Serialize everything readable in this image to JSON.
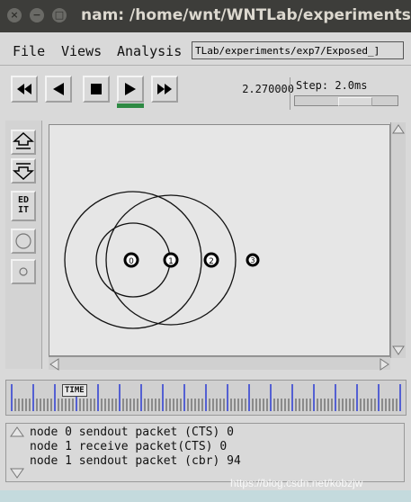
{
  "window": {
    "title": "nam: /home/wnt/WNTLab/experiments/e",
    "close_glyph": "×",
    "minimize_glyph": "−",
    "maximize_glyph": "□"
  },
  "menu": {
    "file": "File",
    "views": "Views",
    "analysis": "Analysis",
    "path": "TLab/experiments/exp7/Exposed_]"
  },
  "playback": {
    "time": "2.270000",
    "step_label": "Step: 2.0ms"
  },
  "tools": {
    "edit": [
      "ED",
      "IT"
    ]
  },
  "nodes": [
    {
      "label": "0"
    },
    {
      "label": "1"
    },
    {
      "label": "2"
    },
    {
      "label": "3"
    }
  ],
  "timeline": {
    "label": "TIME"
  },
  "annotations": [
    "node 0 sendout packet (CTS) 0",
    "node 1 receive packet(CTS) 0",
    "node 1 sendout packet (cbr) 94"
  ],
  "watermark": "https://blog.csdn.net/kobzjw",
  "colors": {
    "titlebar": "#3d3d3a",
    "panel": "#d9d9d9",
    "canvas": "#e6e6e6",
    "timeline_tick": "#2a3ad4",
    "play_indicator": "#2e8a44"
  }
}
